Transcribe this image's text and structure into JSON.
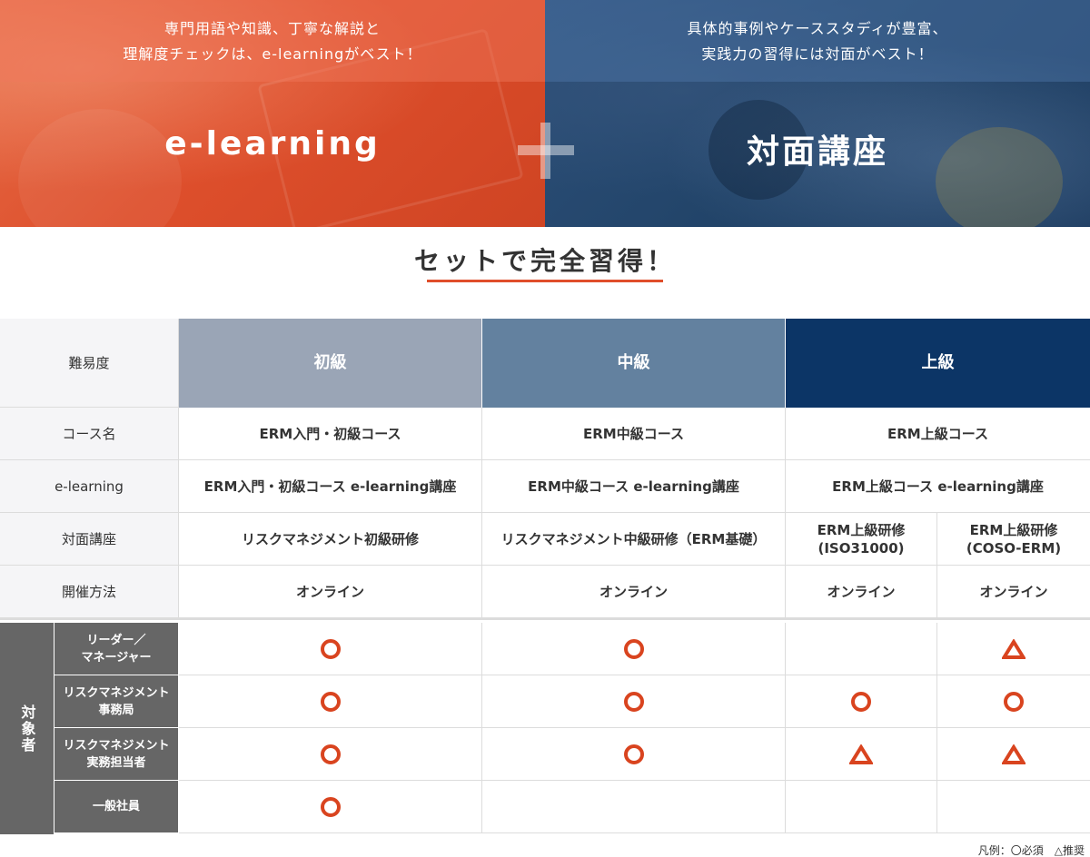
{
  "hero": {
    "left": {
      "caption_line1": "専門用語や知識、丁寧な解説と",
      "caption_line2": "理解度チェックは、e-learningがベスト！",
      "title": "e-learning",
      "color": "#de4f2c"
    },
    "right": {
      "caption_line1": "具体的事例やケーススタディが豊富、",
      "caption_line2": "実践力の習得には対面がベスト！",
      "title": "対面講座",
      "color": "#224469"
    }
  },
  "subtitle": "セットで完全習得！",
  "table": {
    "header": {
      "label": "難易度",
      "beginner": "初級",
      "intermediate": "中級",
      "advanced": "上級",
      "colors": {
        "beginner": "#9aa5b6",
        "intermediate": "#63819f",
        "advanced": "#0c3566"
      }
    },
    "rows": {
      "course_name": {
        "label": "コース名",
        "beginner": "ERM入門・初級コース",
        "intermediate": "ERM中級コース",
        "advanced": "ERM上級コース"
      },
      "elearning": {
        "label": "e-learning",
        "beginner": "ERM入門・初級コース  e-learning講座",
        "intermediate": "ERM中級コース  e-learning講座",
        "advanced": "ERM上級コース  e-learning講座"
      },
      "classroom": {
        "label": "対面講座",
        "beginner": "リスクマネジメント初級研修",
        "intermediate": "リスクマネジメント中級研修（ERM基礎）",
        "advanced_a_line1": "ERM上級研修",
        "advanced_a_line2": "(ISO31000)",
        "advanced_b_line1": "ERM上級研修",
        "advanced_b_line2": "(COSO-ERM)"
      },
      "method": {
        "label": "開催方法",
        "beginner": "オンライン",
        "intermediate": "オンライン",
        "advanced_a": "オンライン",
        "advanced_b": "オンライン"
      }
    },
    "target": {
      "label": "対象者",
      "groups": [
        {
          "line1": "リーダー／",
          "line2": "マネージャー",
          "marks": [
            "circle",
            "circle",
            "",
            "triangle"
          ]
        },
        {
          "line1": "リスクマネジメント",
          "line2": "事務局",
          "marks": [
            "circle",
            "circle",
            "circle",
            "circle"
          ]
        },
        {
          "line1": "リスクマネジメント",
          "line2": "実務担当者",
          "marks": [
            "circle",
            "circle",
            "triangle",
            "triangle"
          ]
        },
        {
          "line1": "一般社員",
          "line2": "",
          "marks": [
            "circle",
            "",
            "",
            ""
          ]
        }
      ],
      "mark_color": "#d9441f"
    }
  },
  "legend": "凡例：〇必須　△推奨"
}
